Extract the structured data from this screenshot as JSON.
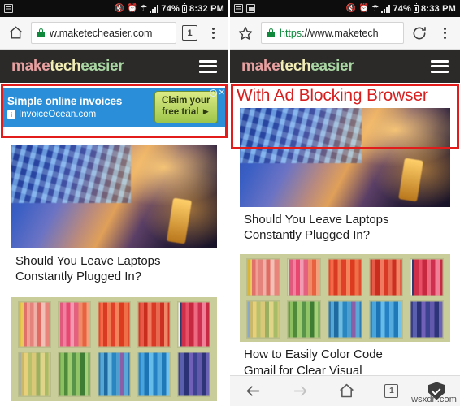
{
  "colors": {
    "accent_red": "#e21b1b",
    "status_bar_bg": "#0d0d0d",
    "site_header_bg": "#2b2a29",
    "lock_green": "#0f8a3c",
    "ad_blue": "#2a8fd8"
  },
  "left_panel": {
    "status_bar": {
      "notification_icons": [
        "sd-card-icon"
      ],
      "mute_icon": "volume-mute-icon",
      "alarm_icon": "alarm-clock-icon",
      "wifi_icon": "wifi-icon",
      "signal_icon": "cell-signal-icon",
      "battery_percent": "74%",
      "battery_icon": "battery-icon",
      "time": "8:32 PM"
    },
    "chrome": {
      "home_icon": "home-icon",
      "lock_icon": "lock-icon",
      "url": "w.maketecheasier.com",
      "url_scheme": "",
      "tab_count": "1",
      "menu_icon": "kebab-menu-icon"
    },
    "site_header": {
      "logo_part1": "make",
      "logo_part2": "tech",
      "logo_part3": "easier",
      "menu_icon": "hamburger-menu-icon"
    },
    "ad": {
      "headline": "Simple online invoices",
      "badge": "i",
      "advertiser": "InvoiceOcean.com",
      "cta_line1": "Claim your",
      "cta_line2": "free trial ►",
      "info_icon": "ad-info-icon",
      "close_icon": "ad-close-icon"
    },
    "articles": [
      {
        "title": "Should You Leave Laptops Constantly Plugged In?",
        "image": "laptop-keyboard-photo"
      },
      {
        "title": "",
        "image": "colorful-bookshelf-photo"
      }
    ]
  },
  "right_panel": {
    "status_bar": {
      "notification_icons": [
        "sd-card-icon",
        "screenshot-icon"
      ],
      "mute_icon": "volume-mute-icon",
      "alarm_icon": "alarm-clock-icon",
      "wifi_icon": "wifi-icon",
      "signal_icon": "cell-signal-icon",
      "battery_percent": "74%",
      "battery_icon": "battery-icon",
      "time": "8:33 PM"
    },
    "chrome": {
      "star_icon": "bookmark-star-icon",
      "lock_icon": "lock-icon",
      "url_scheme": "https",
      "url_rest": "://www.maketech",
      "reload_icon": "reload-icon",
      "menu_icon": "kebab-menu-icon"
    },
    "site_header": {
      "logo_part1": "make",
      "logo_part2": "tech",
      "logo_part3": "easier",
      "menu_icon": "hamburger-menu-icon"
    },
    "annotation": "With Ad Blocking Browser",
    "articles": [
      {
        "title": "Should You Leave Laptops Constantly Plugged In?",
        "image": "laptop-keyboard-photo"
      },
      {
        "title": "How to Easily Color Code Gmail for Clear Visual",
        "image": "colorful-bookshelf-photo"
      }
    ],
    "bottom_nav": {
      "back_icon": "arrow-back-icon",
      "forward_icon": "arrow-forward-icon",
      "home_icon": "home-icon",
      "tab_count": "1",
      "shield_icon": "shield-check-icon"
    }
  },
  "watermark": "wsxdn.com"
}
